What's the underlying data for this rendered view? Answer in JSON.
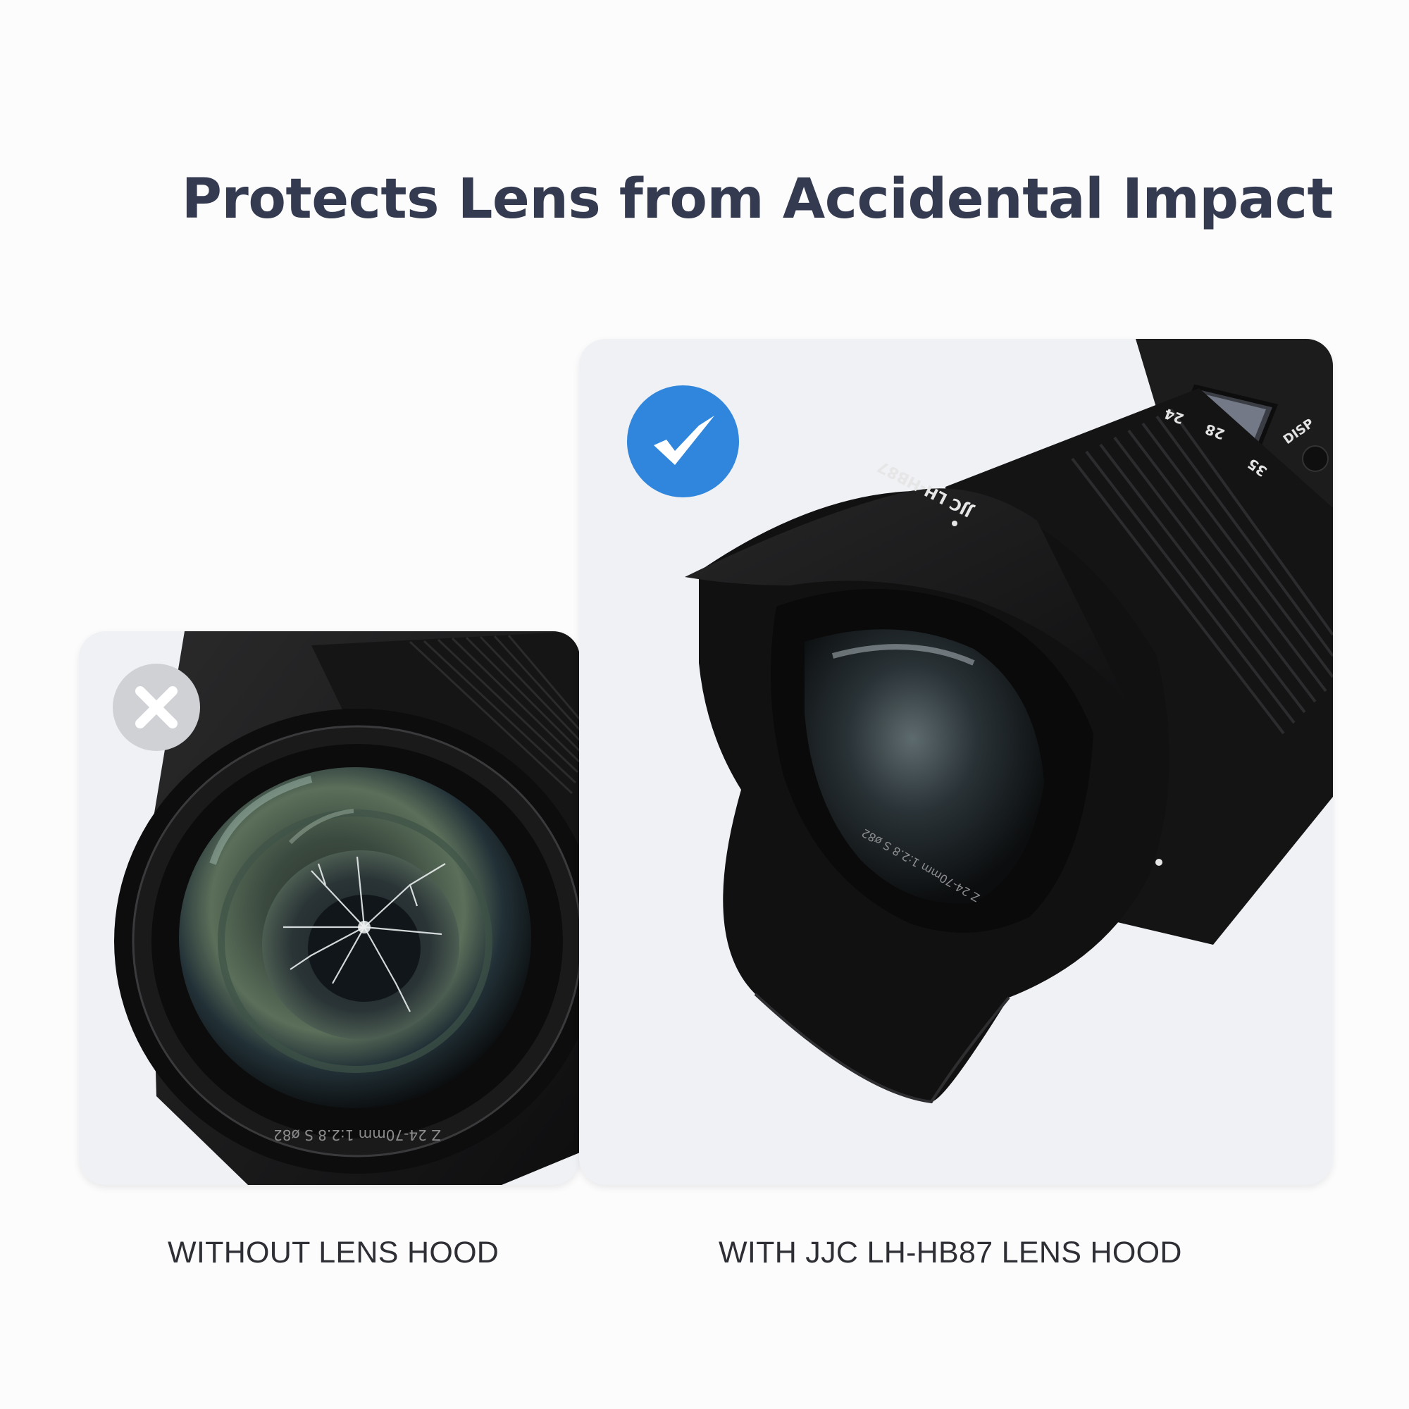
{
  "headline": "Protects Lens from Accidental Impact",
  "left_panel": {
    "caption": "WITHOUT LENS HOOD",
    "badge": "x-icon",
    "lens_text": "Z 24-70mm 1:2.8 S ø82"
  },
  "right_panel": {
    "caption": "WITH JJC LH-HB87 LENS HOOD",
    "badge": "checkmark-icon",
    "hood_text": "JJC LH-HB87",
    "lens_text": "Z 24-70mm 1:2.8 S ø82",
    "zoom_marks": [
      "24",
      "28",
      "35"
    ],
    "button_label": "DISP"
  },
  "colors": {
    "headline": "#343a4f",
    "card_bg": "#eff1f5",
    "check_badge": "#2f86dc",
    "x_badge": "#cfd1d4"
  }
}
